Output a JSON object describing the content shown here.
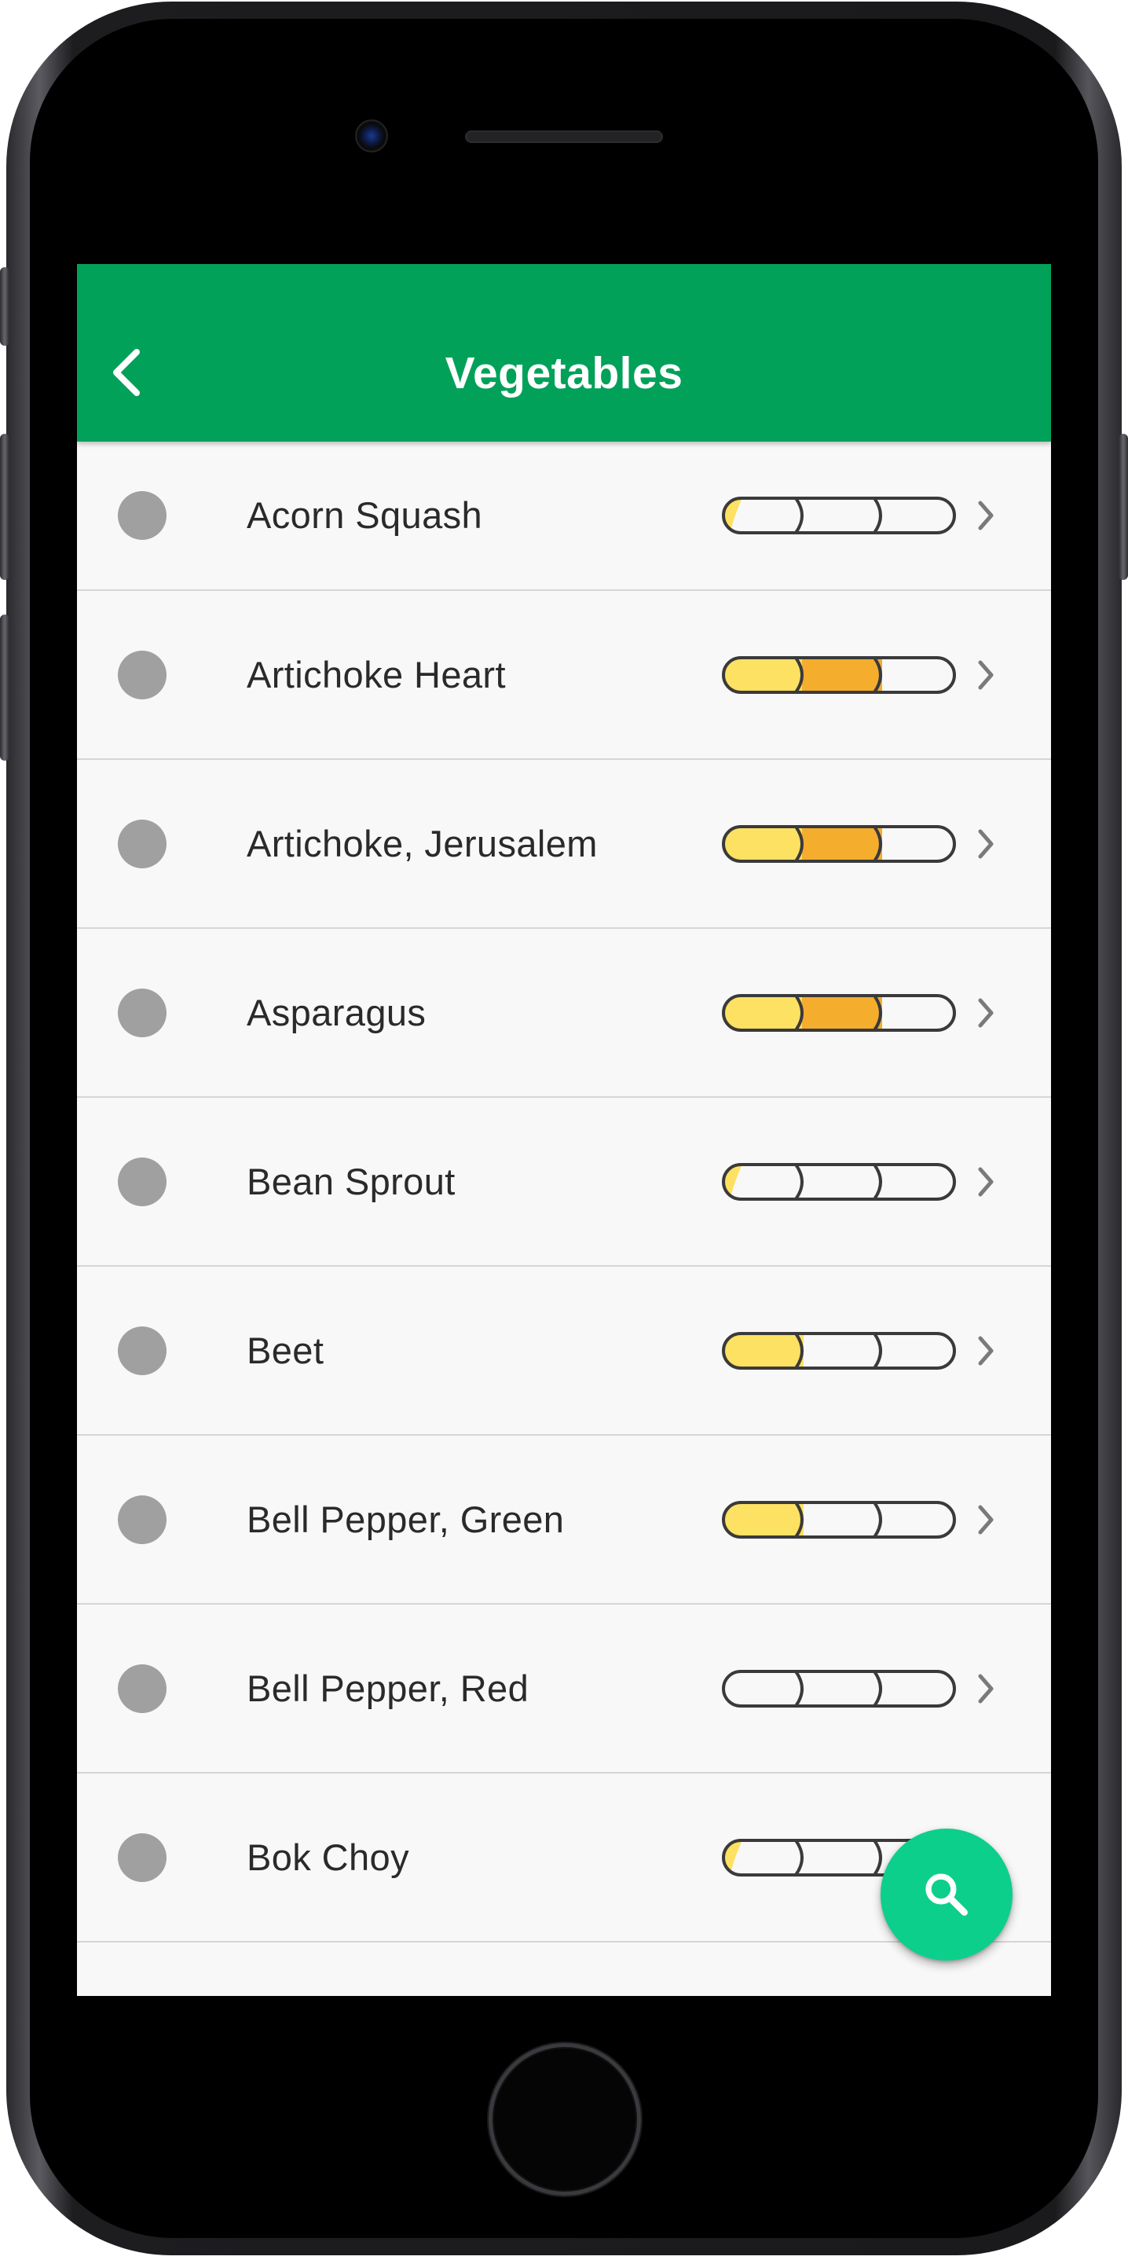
{
  "header": {
    "title": "Vegetables",
    "background": "#02a15a"
  },
  "list": {
    "items": [
      {
        "label": "Acorn Squash",
        "level": 0.25
      },
      {
        "label": "Artichoke Heart",
        "level": 2
      },
      {
        "label": "Artichoke, Jerusalem",
        "level": 2
      },
      {
        "label": "Asparagus",
        "level": 2
      },
      {
        "label": "Bean Sprout",
        "level": 0.25
      },
      {
        "label": "Beet",
        "level": 1
      },
      {
        "label": "Bell Pepper, Green",
        "level": 1
      },
      {
        "label": "Bell Pepper, Red",
        "level": 0
      },
      {
        "label": "Bok Choy",
        "level": 0.25
      },
      {
        "label": "",
        "level": 0
      }
    ],
    "meter_segments": 3,
    "meter_colors": [
      "#fde162",
      "#f5ad2e",
      "#f8f8f8"
    ]
  },
  "fab": {
    "icon": "search-icon",
    "color": "#0ccf8c"
  },
  "icons": {
    "back": "chevron-left-icon",
    "row_arrow": "chevron-right-icon"
  }
}
